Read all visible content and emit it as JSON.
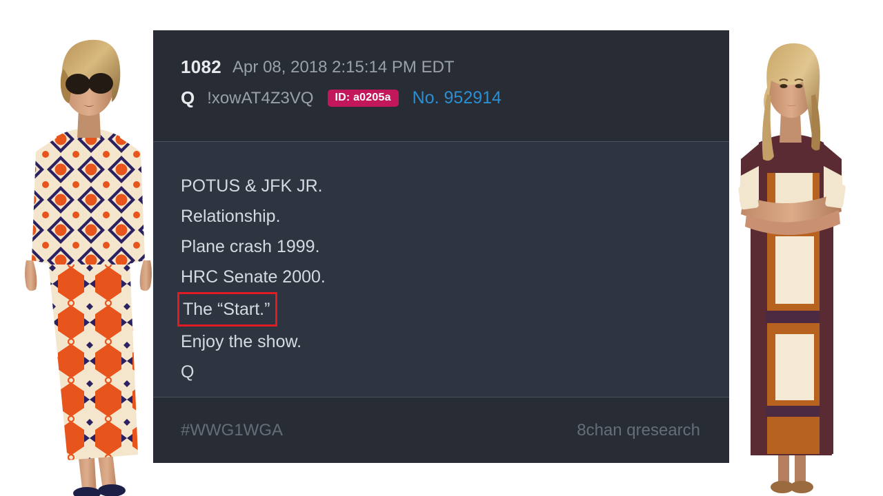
{
  "post": {
    "number": "1082",
    "date": "Apr 08, 2018 2:15:14 PM EDT",
    "q_label": "Q",
    "tripcode": "!xowAT4Z3VQ",
    "id_badge": "ID: a0205a",
    "post_no": "No. 952914",
    "body_lines": [
      {
        "text": "POTUS & JFK JR.",
        "highlighted": false
      },
      {
        "text": "Relationship.",
        "highlighted": false
      },
      {
        "text": "Plane crash 1999.",
        "highlighted": false
      },
      {
        "text": "HRC Senate 2000.",
        "highlighted": false
      },
      {
        "text": "The “Start.”",
        "highlighted": true
      },
      {
        "text": "Enjoy the show.",
        "highlighted": false
      },
      {
        "text": "Q",
        "highlighted": false
      }
    ],
    "footer_left": "#WWG1WGA",
    "footer_right": "8chan qresearch"
  },
  "figures": {
    "left": {
      "description": "woman-walking-in-orange-navy-cream-geometric-print-dress-with-sunglasses"
    },
    "right": {
      "description": "woman-arms-crossed-in-brown-orange-cream-colorblock-dress"
    }
  },
  "colors": {
    "page_background": "#ffffff",
    "card_header": "#282c35",
    "card_body": "#2e3540",
    "card_footer": "#282c35",
    "divider": "#4a525e",
    "post_number_text": "#e8eaed",
    "date_text": "#9aa0aa",
    "id_badge_background": "#c2185b",
    "id_badge_text": "#ffffff",
    "post_no_link": "#2b8fd4",
    "body_text": "#d6dae0",
    "highlight_border": "#e01b24",
    "footer_text": "#666d78"
  }
}
